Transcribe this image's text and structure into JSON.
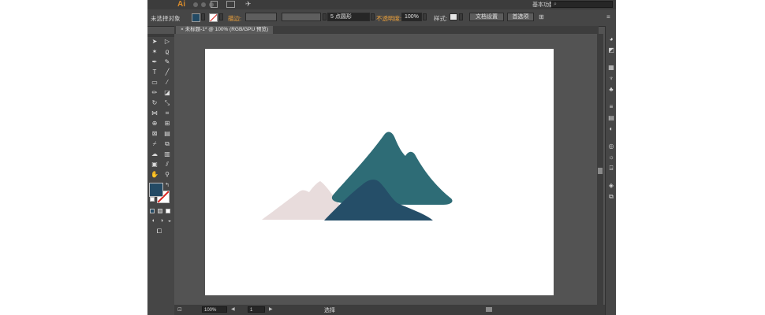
{
  "app": {
    "logo": "Ai",
    "workspace": "基本功能",
    "search_placeholder": "",
    "search_glyph": "⌕"
  },
  "control_bar": {
    "selection_label": "未选择对象",
    "stroke_label": "描边:",
    "brush_label": "5 点圆形",
    "opacity_label": "不透明度:",
    "opacity_value": "100%",
    "style_label": "样式:",
    "doc_setup_label": "文档设置",
    "preferences_label": "首选项"
  },
  "document_tab": {
    "title": "未标题-1* @ 100% (RGB/GPU 预览)",
    "close_glyph": "×"
  },
  "colors": {
    "fill": "#234a64",
    "stroke": "none",
    "mountain_back_left": "#e8dcdc",
    "mountain_back_right": "#2e6c76",
    "mountain_front": "#254e68",
    "accent_orange": "#f0a33b"
  },
  "tools": [
    "selection-tool",
    "direct-selection-tool",
    "magic-wand-tool",
    "lasso-tool",
    "pen-tool",
    "curvature-tool",
    "type-tool",
    "line-tool",
    "rectangle-tool",
    "paintbrush-tool",
    "pencil-tool",
    "eraser-tool",
    "rotate-tool",
    "scale-tool",
    "width-tool",
    "free-transform-tool",
    "shape-builder-tool",
    "perspective-grid-tool",
    "mesh-tool",
    "gradient-tool",
    "eyedropper-tool",
    "blend-tool",
    "symbol-sprayer-tool",
    "column-graph-tool",
    "artboard-tool",
    "slice-tool",
    "hand-tool",
    "zoom-tool"
  ],
  "status_bar": {
    "zoom_value": "100%",
    "page_value": "1",
    "selection_info": "选择"
  }
}
